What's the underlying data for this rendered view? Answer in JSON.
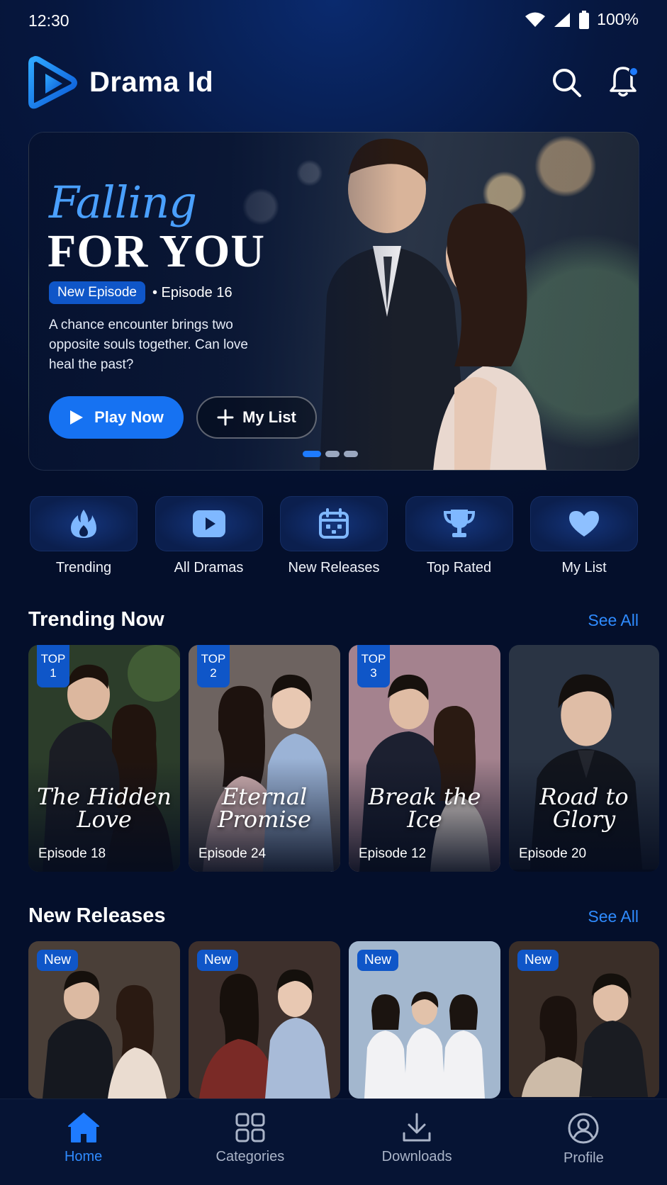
{
  "status": {
    "time": "12:30",
    "battery": "100%"
  },
  "header": {
    "app_title": "Drama Id"
  },
  "hero": {
    "title_script": "Falling",
    "title_main": "FOR YOU",
    "badge": "New Episode",
    "episode": "• Episode 16",
    "description": "A chance encounter brings two opposite souls together. Can love heal the past?",
    "play_label": "Play Now",
    "mylist_label": "My List"
  },
  "quick_access": [
    {
      "label": "Trending",
      "icon": "flame-icon"
    },
    {
      "label": "All Dramas",
      "icon": "play-icon"
    },
    {
      "label": "New Releases",
      "icon": "calendar-icon"
    },
    {
      "label": "Top Rated",
      "icon": "trophy-icon"
    },
    {
      "label": "My List",
      "icon": "heart-icon"
    }
  ],
  "trending": {
    "title": "Trending Now",
    "see_all": "See All",
    "items": [
      {
        "rank_label": "TOP",
        "rank": "1",
        "title": "The Hidden Love",
        "episode": "Episode 18"
      },
      {
        "rank_label": "TOP",
        "rank": "2",
        "title": "Eternal Promise",
        "episode": "Episode 24"
      },
      {
        "rank_label": "TOP",
        "rank": "3",
        "title": "Break the Ice",
        "episode": "Episode 12"
      },
      {
        "title": "Road to Glory",
        "episode": "Episode 20"
      }
    ]
  },
  "new_releases": {
    "title": "New Releases",
    "see_all": "See All",
    "badge": "New"
  },
  "bottom_nav": [
    {
      "label": "Home",
      "icon": "home-icon",
      "active": true
    },
    {
      "label": "Categories",
      "icon": "grid-icon"
    },
    {
      "label": "Downloads",
      "icon": "download-icon"
    },
    {
      "label": "Profile",
      "icon": "profile-icon"
    }
  ],
  "colors": {
    "accent": "#1672f2",
    "link": "#2f8bff",
    "background": "#06173f"
  }
}
